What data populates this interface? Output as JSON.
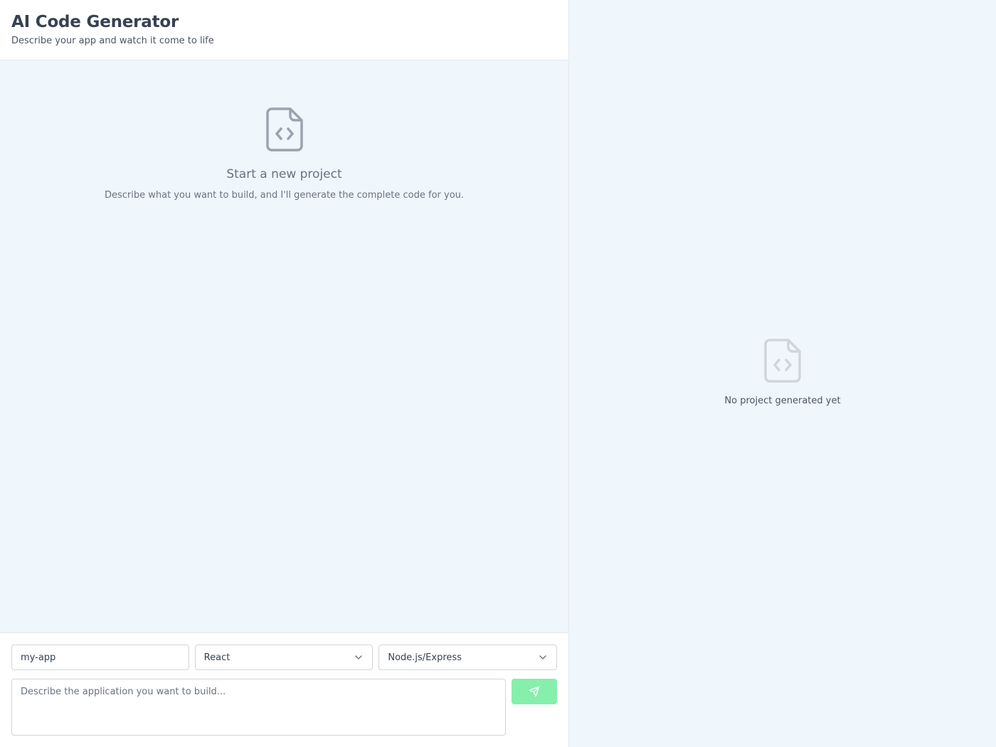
{
  "header": {
    "title": "AI Code Generator",
    "subtitle": "Describe your app and watch it come to life"
  },
  "chat": {
    "empty_icon": "file-code-icon",
    "empty_title": "Start a new project",
    "empty_description": "Describe what you want to build, and I'll generate the complete code for you."
  },
  "composer": {
    "project_name_value": "my-app",
    "frontend_select_value": "React",
    "backend_select_value": "Node.js/Express",
    "prompt_placeholder": "Describe the application you want to build...",
    "send_icon": "send-icon",
    "send_button_color": "#86efac"
  },
  "preview": {
    "empty_icon": "file-code-icon",
    "empty_text": "No project generated yet"
  }
}
